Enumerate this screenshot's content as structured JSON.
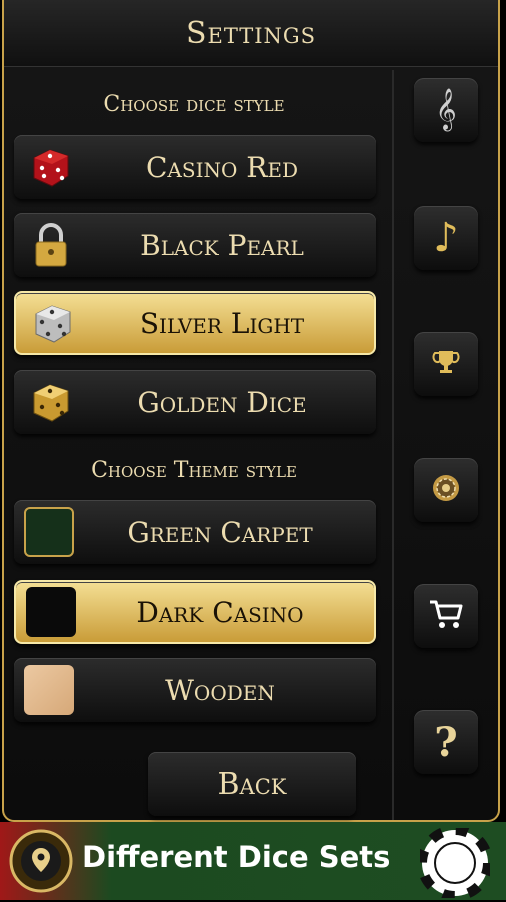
{
  "header": {
    "title": "Settings"
  },
  "dice_section": {
    "heading": "Choose dice style",
    "options": [
      {
        "label": "Casino Red",
        "selected": false,
        "icon": "red-dice-icon",
        "color": "#c41a1a"
      },
      {
        "label": "Black Pearl",
        "selected": false,
        "icon": "padlock-icon",
        "color": "#d4a840"
      },
      {
        "label": "Silver Light",
        "selected": true,
        "icon": "silver-dice-icon",
        "color": "#cfcfcf"
      },
      {
        "label": "Golden Dice",
        "selected": false,
        "icon": "gold-dice-icon",
        "color": "#d9a93e"
      }
    ]
  },
  "theme_section": {
    "heading": "Choose Theme style",
    "options": [
      {
        "label": "Green Carpet",
        "selected": false,
        "swatch": "#15301a"
      },
      {
        "label": "Dark Casino",
        "selected": true,
        "swatch": "#0a0a0a"
      },
      {
        "label": "Wooden",
        "selected": false,
        "swatch": "#e2b98f"
      }
    ]
  },
  "sidebar": {
    "buttons": [
      {
        "name": "music-settings-icon",
        "glyph": "𝄞"
      },
      {
        "name": "sound-note-icon",
        "glyph": "♪"
      },
      {
        "name": "trophy-icon",
        "glyph": "🏆"
      },
      {
        "name": "casino-chip-icon",
        "glyph": "◉"
      },
      {
        "name": "shopping-cart-icon",
        "glyph": "🛒"
      },
      {
        "name": "help-icon",
        "glyph": "?"
      }
    ]
  },
  "back": {
    "label": "Back"
  },
  "banner": {
    "text": "Different Dice Sets"
  },
  "colors": {
    "gold": "#c8a24a",
    "text": "#ecdcb0",
    "selected_bg": "#e6c66c",
    "banner_green": "#1e4d22",
    "banner_red": "#a01818"
  }
}
